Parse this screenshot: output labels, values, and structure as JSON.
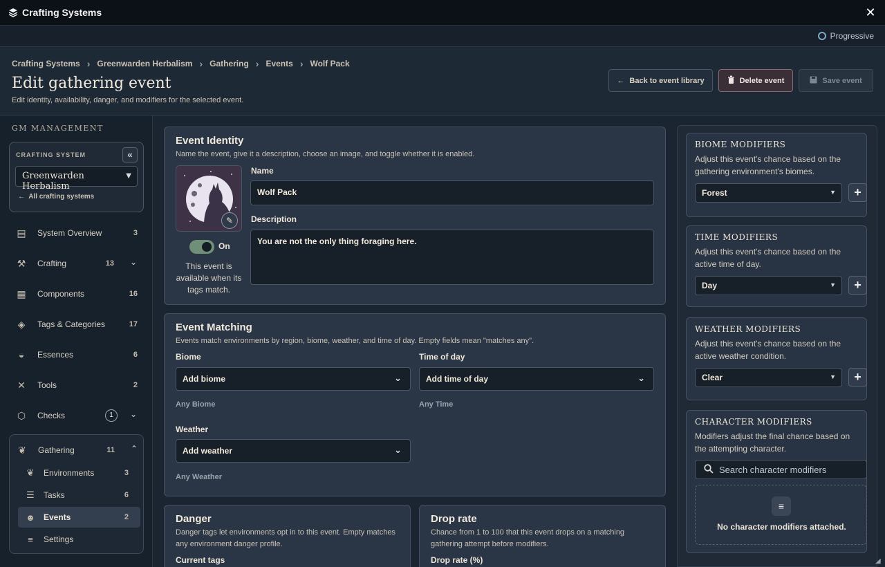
{
  "app": {
    "title": "Crafting Systems",
    "mode": "Progressive"
  },
  "header": {
    "breadcrumbs": [
      "Crafting Systems",
      "Greenwarden Herbalism",
      "Gathering",
      "Events",
      "Wolf Pack"
    ],
    "title": "Edit gathering event",
    "subtitle": "Edit identity, availability, danger, and modifiers for the selected event.",
    "back_label": "Back to event library",
    "delete_label": "Delete event",
    "save_label": "Save event"
  },
  "sidebar": {
    "heading": "GM MANAGEMENT",
    "crafting_system_label": "CRAFTING SYSTEM",
    "crafting_system_value": "Greenwarden Herbalism",
    "all_systems_label": "All crafting systems",
    "items": [
      {
        "label": "System Overview",
        "count": "3"
      },
      {
        "label": "Crafting",
        "count": "13"
      },
      {
        "label": "Components",
        "count": "16"
      },
      {
        "label": "Tags & Categories",
        "count": "17"
      },
      {
        "label": "Essences",
        "count": "6"
      },
      {
        "label": "Tools",
        "count": "2"
      },
      {
        "label": "Checks",
        "count": "1"
      },
      {
        "label": "Gathering",
        "count": "11"
      }
    ],
    "gathering_sub": [
      {
        "label": "Environments",
        "count": "3"
      },
      {
        "label": "Tasks",
        "count": "6"
      },
      {
        "label": "Events",
        "count": "2"
      },
      {
        "label": "Settings",
        "count": ""
      }
    ]
  },
  "identity": {
    "title": "Event Identity",
    "desc": "Name the event, give it a description, choose an image, and toggle whether it is enabled.",
    "name_label": "Name",
    "name_value": "Wolf Pack",
    "description_label": "Description",
    "description_value": "You are not the only thing foraging here.",
    "toggle_label": "On",
    "availability_text": "This event is available when its tags match."
  },
  "matching": {
    "title": "Event Matching",
    "desc": "Events match environments by region, biome, weather, and time of day. Empty fields mean \"matches any\".",
    "biome_label": "Biome",
    "biome_placeholder": "Add biome",
    "biome_hint": "Any Biome",
    "time_label": "Time of day",
    "time_placeholder": "Add time of day",
    "time_hint": "Any Time",
    "weather_label": "Weather",
    "weather_placeholder": "Add weather",
    "weather_hint": "Any Weather"
  },
  "danger": {
    "title": "Danger",
    "desc": "Danger tags let environments opt in to this event. Empty matches any environment danger profile.",
    "current_tags_label": "Current tags"
  },
  "droprate": {
    "title": "Drop rate",
    "desc": "Chance from 1 to 100 that this event drops on a matching gathering attempt before modifiers.",
    "field_label": "Drop rate (%)"
  },
  "modifiers": {
    "biome": {
      "title": "BIOME MODIFIERS",
      "desc": "Adjust this event's chance based on the gathering environment's biomes.",
      "value": "Forest"
    },
    "time": {
      "title": "TIME MODIFIERS",
      "desc": "Adjust this event's chance based on the active time of day.",
      "value": "Day"
    },
    "weather": {
      "title": "WEATHER MODIFIERS",
      "desc": "Adjust this event's chance based on the active weather condition.",
      "value": "Clear"
    },
    "character": {
      "title": "CHARACTER MODIFIERS",
      "desc": "Modifiers adjust the final chance based on the attempting character.",
      "search_placeholder": "Search character modifiers",
      "empty_text": "No character modifiers attached."
    }
  },
  "colors": {
    "accent_toggle": "#6f8f79",
    "danger_border": "#8b6a72",
    "background": "#1b2531"
  }
}
